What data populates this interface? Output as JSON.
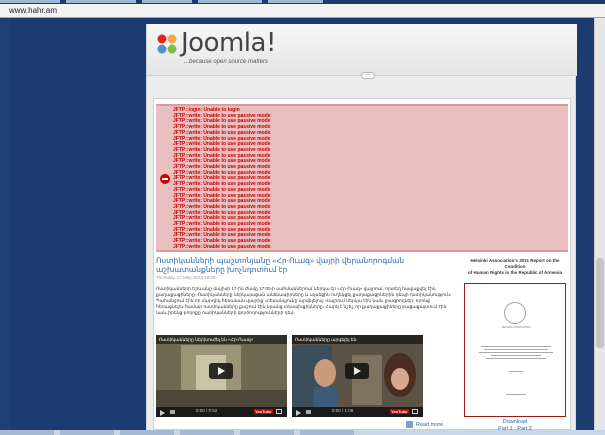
{
  "browser": {
    "url": "www.hahr.am"
  },
  "header": {
    "logo_text": "Joomla!",
    "tagline": "...because open source matters",
    "collapse_symbol": "—"
  },
  "errors": [
    "JFTP::login: Unable to login",
    "JFTP::write: Unable to use passive mode",
    "JFTP::write: Unable to use passive mode",
    "JFTP::write: Unable to use passive mode",
    "JFTP::write: Unable to use passive mode",
    "JFTP::write: Unable to use passive mode",
    "JFTP::write: Unable to use passive mode",
    "JFTP::write: Unable to use passive mode",
    "JFTP::write: Unable to use passive mode",
    "JFTP::write: Unable to use passive mode",
    "JFTP::write: Unable to use passive mode",
    "JFTP::write: Unable to use passive mode",
    "JFTP::write: Unable to use passive mode",
    "JFTP::write: Unable to use passive mode",
    "JFTP::write: Unable to use passive mode",
    "JFTP::write: Unable to use passive mode",
    "JFTP::write: Unable to use passive mode",
    "JFTP::write: Unable to use passive mode",
    "JFTP::write: Unable to use passive mode",
    "JFTP::write: Unable to use passive mode",
    "JFTP::write: Unable to use passive mode",
    "JFTP::write: Unable to use passive mode",
    "JFTP::write: Unable to use passive mode",
    "JFTP::write: Unable to use passive mode",
    "JFTP::write: Unable to use passive mode"
  ],
  "article": {
    "title": "Ոստիկանների պաշտոնյանը «Հր-Ուազ» վայրի վերանորոգման աշխատանքները խոչնդոտում էր",
    "date": "Thursday, 17 May 2012 18:09",
    "body": "Ոստիկանների Երևանը մայիսի 17-ին ժամը 17:00-ի սահմաններում ներկա էր «Հր-Ուազ» վայրում, որտեղ հավաքվել էին քաղաքացիները։ Ոստիկանները ներկայացան անձնագիրները և սկսեցին ուղեկցել քաղաքացիներին դեպի ոստիկանություն։ Պահանջում էին որ մարդիկ հեռանան վայրից՝ տեսանկյունը արգելելով։ Վայրում ներկա էին նաև լրագրողներ, որոնց հեռացնելու համար ոստիկանները քաշում էին նրանց տեսախցիկները։ Հարկ է նշել, որ քաղաքացիները բացացայտում էին նաև իրենց բողոքը ոստիկանների գործողությունների դեմ։",
    "read_more": "Read more"
  },
  "videos": [
    {
      "title": "Ոստիկանները ներխուժել են «Հր-Ուազ»",
      "time": "0:00 / 0:52",
      "yt_label": "YouTube"
    },
    {
      "title": "Ոստիկանները արգելել են",
      "time": "0:00 / 1:06",
      "yt_label": "YouTube"
    }
  ],
  "sidebar": {
    "title_line1": "Helsinki Association's 2011 Report on the",
    "title_line2": "Condition",
    "title_line3": "of Human Rights in the Republic of Armenia",
    "seal_text": "HELSINKI ASSOCIATION",
    "download_label": "Download",
    "parts_label": "Part 1 : Part 2"
  },
  "colors": {
    "page_bg": "#1c3b6e",
    "error_bg": "#e9bfbf",
    "error_text": "#c40000",
    "link": "#2a66a8"
  }
}
